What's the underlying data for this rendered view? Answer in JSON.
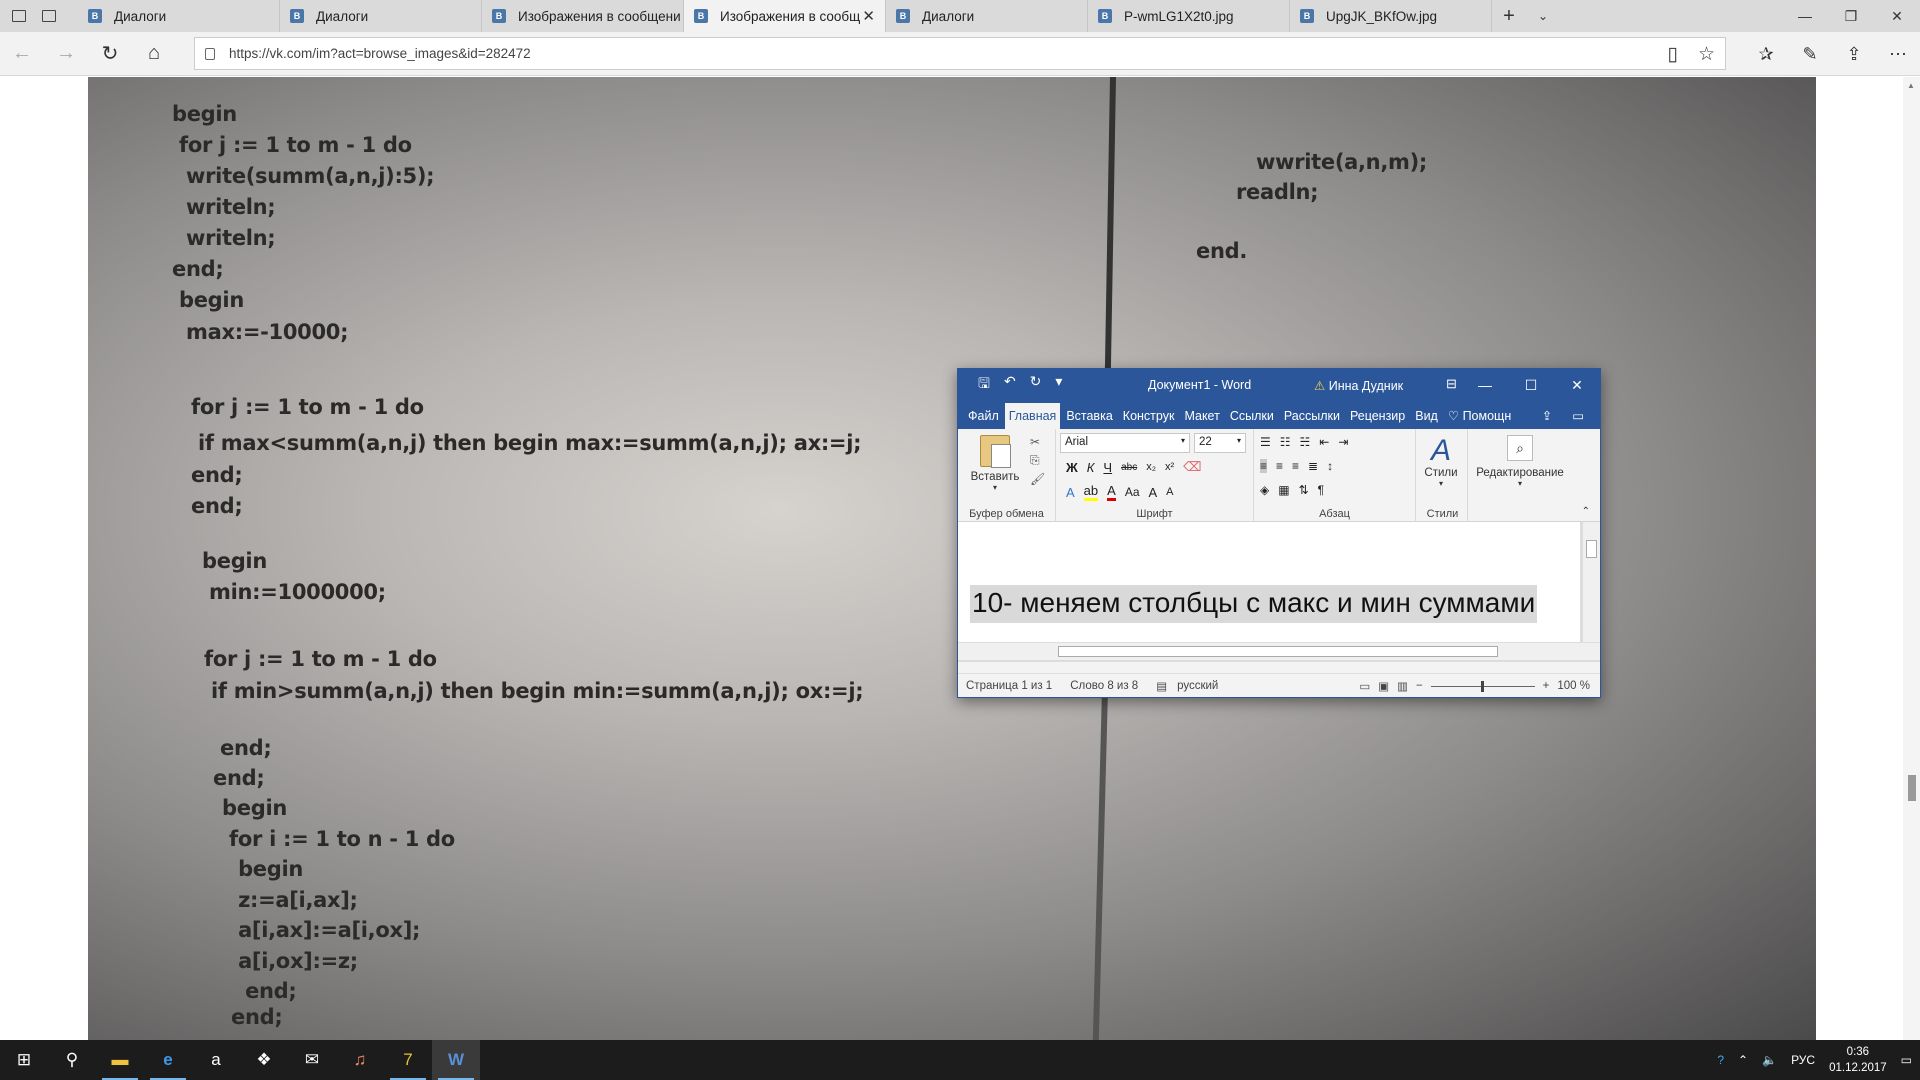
{
  "browser": {
    "tabs": [
      {
        "label": "Диалоги",
        "icon": "vk-icon",
        "active": false
      },
      {
        "label": "Диалоги",
        "icon": "vk-icon",
        "active": false
      },
      {
        "label": "Изображения в сообщени",
        "icon": "vk-icon",
        "active": false
      },
      {
        "label": "Изображения в сообщ",
        "icon": "vk-icon",
        "active": true
      },
      {
        "label": "Диалоги",
        "icon": "vk-icon",
        "active": false
      },
      {
        "label": "P-wmLG1X2t0.jpg",
        "icon": "vk-icon",
        "active": false
      },
      {
        "label": "UpgJK_BKfOw.jpg",
        "icon": "vk-icon",
        "active": false
      }
    ],
    "url": "https://vk.com/im?act=browse_images&id=282472"
  },
  "photo_code": {
    "lines": [
      "begin",
      " for j := 1 to m - 1 do",
      "  write(summ(a,n,j):5);",
      "  writeln;",
      "  writeln;",
      "end;",
      " begin",
      "  max:=-10000;",
      " for j := 1 to m - 1 do",
      "  if max<summ(a,n,j) then begin max:=summ(a,n,j); ax:=j;",
      " end;",
      " end;",
      "  begin",
      "   min:=1000000;",
      "  for j := 1 to m - 1 do",
      "   if min>summ(a,n,j) then begin min:=summ(a,n,j); ox:=j;",
      "    end;",
      "   end;",
      "    begin",
      "     for i := 1 to n - 1 do",
      "      begin",
      "      z:=a[i,ax];",
      "      a[i,ax]:=a[i,ox];",
      "      a[i,ox]:=z;",
      "       end;",
      "     end;"
    ],
    "right_lines": [
      "wwrite(a,n,m);",
      "readln;",
      "end."
    ]
  },
  "word": {
    "title": "Документ1  -  Word",
    "user": "Инна Дудник",
    "tabs": [
      "Файл",
      "Главная",
      "Вставка",
      "Конструк",
      "Макет",
      "Ссылки",
      "Рассылки",
      "Рецензир",
      "Вид"
    ],
    "help": "Помощн",
    "paste_label": "Вставить",
    "font_name": "Arial",
    "font_size": "22",
    "groups": {
      "clipboard": "Буфер обмена",
      "font": "Шрифт",
      "paragraph": "Абзац",
      "styles": "Стили"
    },
    "styles_label": "Стили",
    "editing_label": "Редактирование",
    "document_text": "10- меняем столбцы с макс и мин суммами",
    "status": {
      "page": "Страница 1 из 1",
      "words": "Слово 8 из 8",
      "language": "русский",
      "zoom": "100 %"
    }
  },
  "taskbar": {
    "language": "РУС",
    "time": "0:36",
    "date": "01.12.2017"
  }
}
